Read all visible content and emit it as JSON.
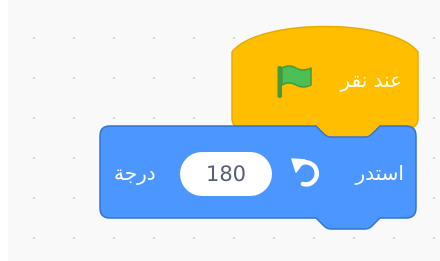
{
  "hat_block": {
    "label": "عند نقر",
    "icon": "green-flag-icon",
    "color": "#ffbf00",
    "border_color": "#e6ac00"
  },
  "turn_block": {
    "label_start": "استدر",
    "icon": "turn-left-icon",
    "input_value": "180",
    "label_end": "درجة",
    "color": "#4c97ff",
    "border_color": "#3373cc"
  },
  "flag_color": "#4cbf56"
}
